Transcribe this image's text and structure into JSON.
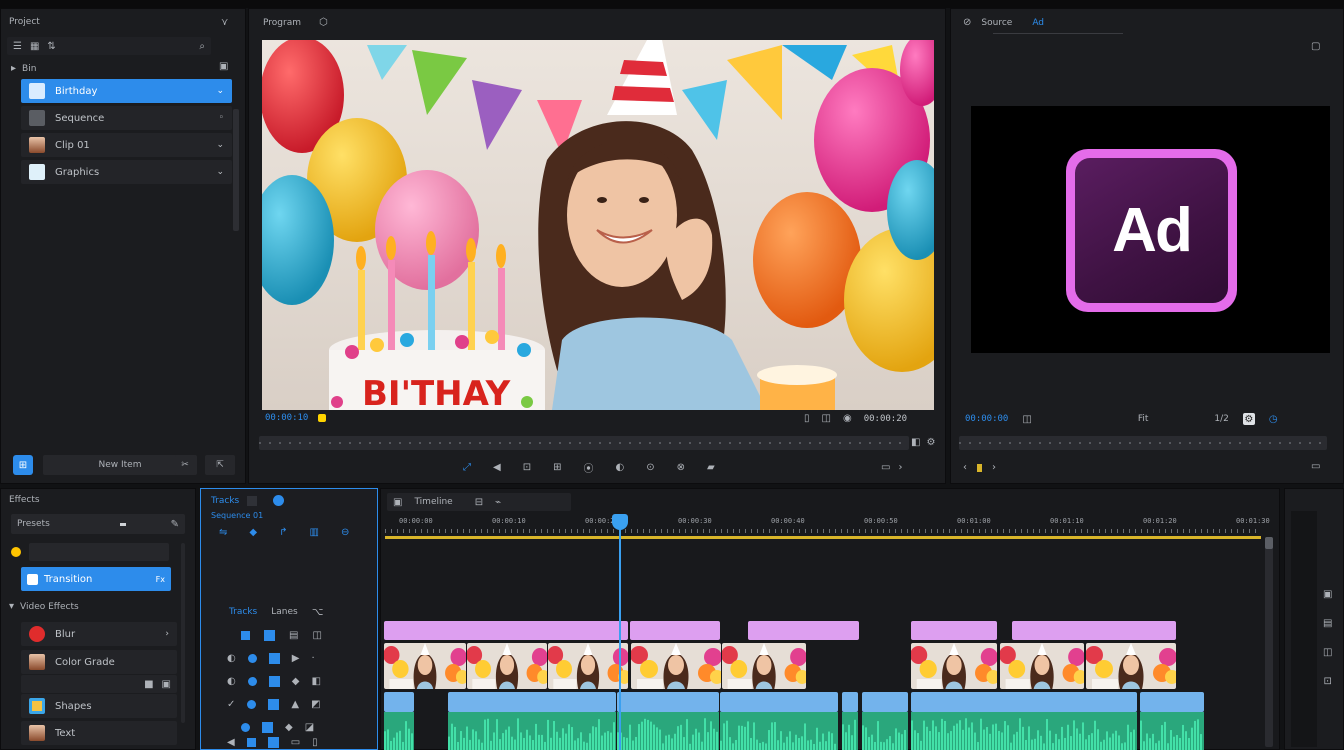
{
  "project_panel": {
    "title": "Project",
    "folder_label": "Bin",
    "items": [
      {
        "label": "Birthday",
        "selected": true
      },
      {
        "label": "Sequence",
        "selected": false
      },
      {
        "label": "Clip 01",
        "selected": false
      },
      {
        "label": "Graphics",
        "selected": false
      }
    ],
    "footer_label": "New Item"
  },
  "source_monitor": {
    "title": "Program",
    "cake_text": "BI'THAY",
    "timecode_left": "00:00:10",
    "timecode_right": "00:00:20"
  },
  "right_monitor": {
    "title": "Source",
    "tab_label": "Ad",
    "logo_text": "Ad",
    "logo_colors": {
      "outer": "#e46cea",
      "inner": "#4b1750",
      "text": "#ffffff"
    },
    "timecode_left": "00:00:00",
    "timecode_mid": "Fit",
    "timecode_right": "1/2"
  },
  "effects_panel": {
    "title": "Effects",
    "search_label": "Presets",
    "selected_item": "Transition",
    "selected_badge": "Fx",
    "group_label": "Video Effects",
    "items": [
      {
        "label": "Blur"
      },
      {
        "label": "Color Grade"
      },
      {
        "label": "Shapes"
      },
      {
        "label": "Text"
      }
    ]
  },
  "track_panel": {
    "title": "Tracks",
    "subtitle": "Sequence 01",
    "header_label": "Tracks",
    "header_label2": "Lanes"
  },
  "timeline": {
    "title": "Timeline",
    "ruler": [
      "00:00:00",
      "00:00:10",
      "00:00:20",
      "00:00:30",
      "00:00:40",
      "00:00:50",
      "00:01:00",
      "00:01:10",
      "00:01:20",
      "00:01:30"
    ]
  },
  "colors": {
    "accent": "#2d8ceb",
    "playhead": "#3aa0f0",
    "clip_pink": "#dd9ff0",
    "clip_blue": "#73b3ec",
    "clip_audio": "#3fd69f",
    "work_area": "#d9b52a"
  }
}
